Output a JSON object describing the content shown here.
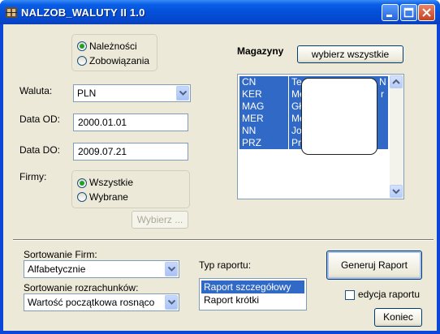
{
  "window": {
    "title": "NALZOB_WALUTY II 1.0"
  },
  "type_radio": {
    "options": [
      "Należności",
      "Zobowiązania"
    ],
    "selected": "Należności"
  },
  "currency": {
    "label": "Waluta:",
    "value": "PLN"
  },
  "date_from": {
    "label": "Data OD:",
    "value": "2000.01.01"
  },
  "date_to": {
    "label": "Data DO:",
    "value": "2009.07.21"
  },
  "firms": {
    "label": "Firmy:",
    "options": [
      "Wszystkie",
      "Wybrane"
    ],
    "selected": "Wszystkie",
    "choose_button": "Wybierz ..."
  },
  "warehouses": {
    "label": "Magazyny",
    "select_all_button": "wybierz wszystkie",
    "rows": [
      {
        "code": "CN",
        "name": "Te",
        "extra": "N"
      },
      {
        "code": "KER",
        "name": "Me",
        "extra": "r"
      },
      {
        "code": "MAG",
        "name": "Gł",
        "extra": ""
      },
      {
        "code": "MER",
        "name": "Me",
        "extra": ""
      },
      {
        "code": "NN",
        "name": "Jo",
        "extra": ""
      },
      {
        "code": "PRZ",
        "name": "Pr",
        "extra": ""
      }
    ]
  },
  "sort_firms": {
    "label": "Sortowanie Firm:",
    "value": "Alfabetycznie"
  },
  "sort_settlements": {
    "label": "Sortowanie rozrachunków:",
    "value": "Wartość początkowa rosnąco"
  },
  "report_type": {
    "label": "Typ raportu:",
    "options": [
      "Raport szczegółowy",
      "Raport krótki"
    ],
    "selected": "Raport szczegółowy"
  },
  "generate_button": "Generuj Raport",
  "edit_report_checkbox": {
    "label": "edycja raportu",
    "checked": false
  },
  "close_button": "Koniec",
  "colors": {
    "title_bar": "#0551da",
    "selection": "#3169c6",
    "client_bg": "#ece9d8",
    "radio_dot": "#21a121"
  }
}
